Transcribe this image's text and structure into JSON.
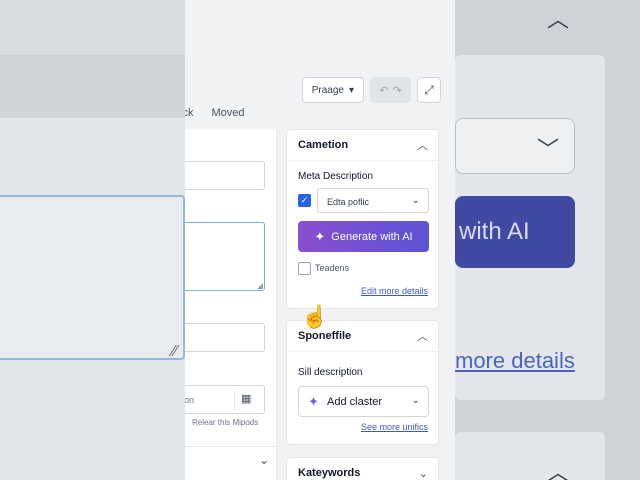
{
  "toolbar": {
    "page_button": "Praage",
    "undo_icon": "undo-icon",
    "redo_icon": "redo-icon",
    "expand_icon": "expand-icon"
  },
  "tabs": [
    {
      "label": "ick"
    },
    {
      "label": "Moved"
    }
  ],
  "left_form": {
    "date_value": "on",
    "hint": "Relear this Mipods"
  },
  "panels": {
    "cametion": {
      "title": "Cametion",
      "meta_label": "Meta Description",
      "select_value": "Edta poflic",
      "generate_label": "Generate with AI",
      "checkbox_label": "Teadens",
      "link": "Edit more details"
    },
    "sponeffile": {
      "title": "Sponeffile",
      "label": "Sill description",
      "add_label": "Add claster",
      "link": "See more unifics"
    },
    "kateywords": {
      "title": "Kateywords"
    }
  },
  "backdrop": {
    "ai_text": "with AI",
    "link_text": "more details"
  },
  "colors": {
    "accent": "#2563eb",
    "gradient_start": "#8a4fd0",
    "gradient_end": "#5b54d6",
    "link": "#3b5bcc"
  }
}
